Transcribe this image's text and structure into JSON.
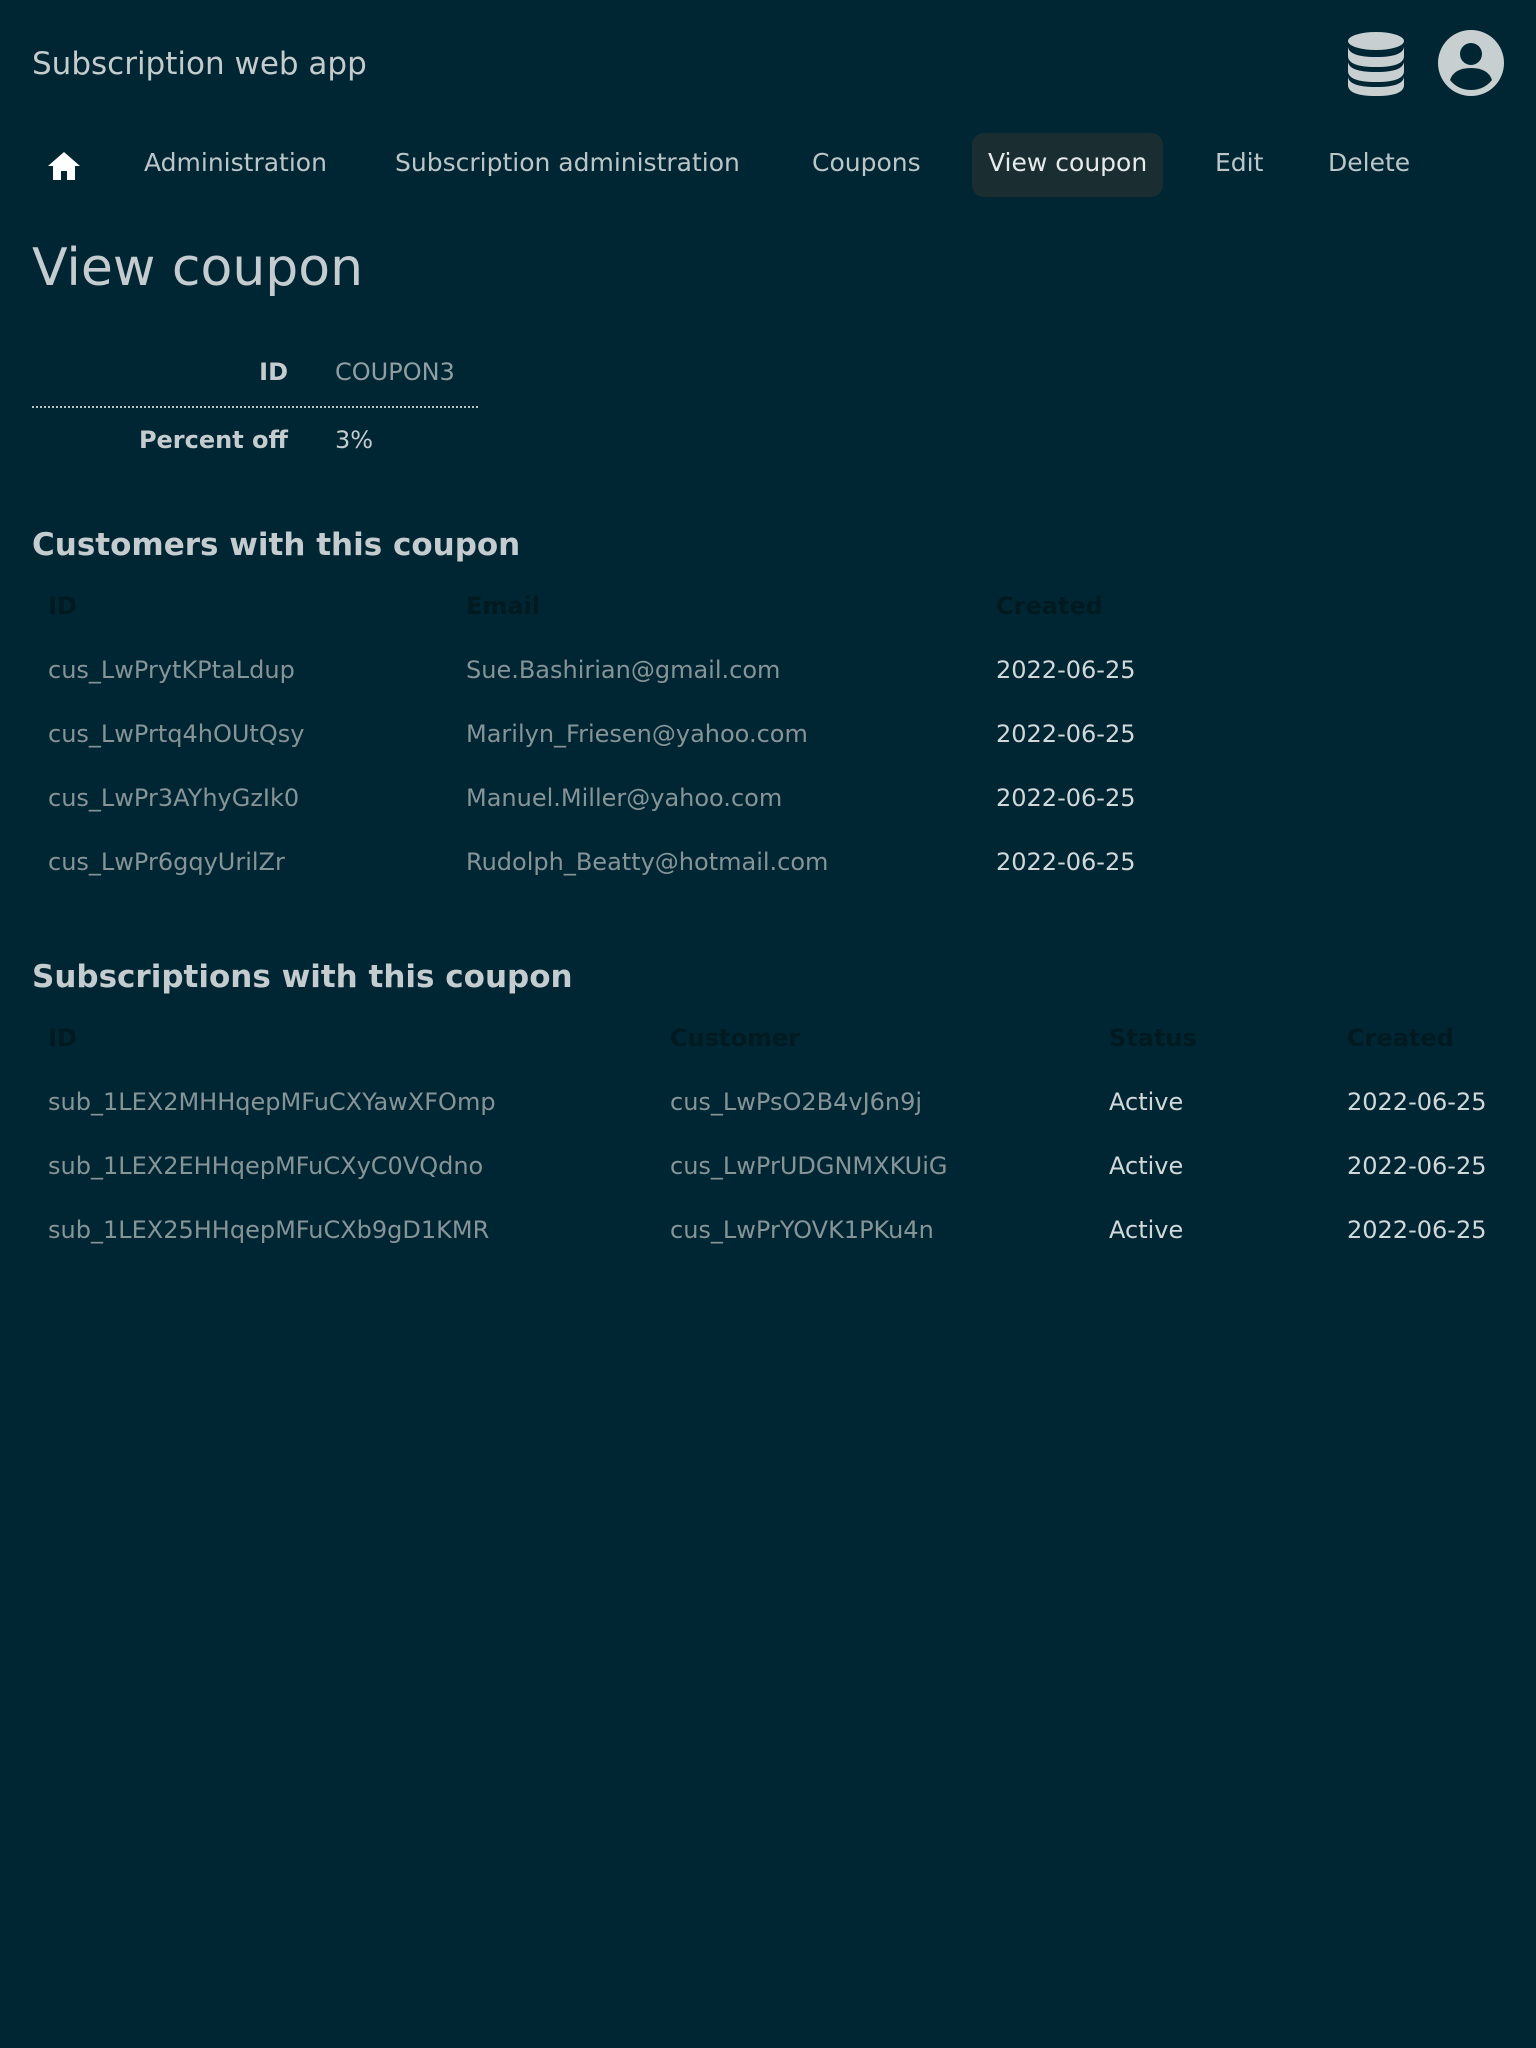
{
  "header": {
    "app_title": "Subscription web app",
    "icons": [
      "database-icon",
      "user-circle-icon"
    ]
  },
  "nav": {
    "home_icon": "home-icon",
    "items": [
      {
        "label": "Administration"
      },
      {
        "label": "Subscription administration"
      },
      {
        "label": "Coupons"
      },
      {
        "label": "View coupon",
        "active": true
      },
      {
        "label": "Edit"
      },
      {
        "label": "Delete"
      }
    ]
  },
  "page": {
    "title": "View coupon"
  },
  "coupon": {
    "id_label": "ID",
    "id_value": "COUPON3",
    "percent_label": "Percent off",
    "percent_value": "3%"
  },
  "customers": {
    "title": "Customers with this coupon",
    "headers": [
      "ID",
      "Email",
      "Created"
    ],
    "rows": [
      {
        "id": "cus_LwPrytKPtaLdup",
        "email": "Sue.Bashirian@gmail.com",
        "created": "2022-06-25"
      },
      {
        "id": "cus_LwPrtq4hOUtQsy",
        "email": "Marilyn_Friesen@yahoo.com",
        "created": "2022-06-25"
      },
      {
        "id": "cus_LwPr3AYhyGzIk0",
        "email": "Manuel.Miller@yahoo.com",
        "created": "2022-06-25"
      },
      {
        "id": "cus_LwPr6gqyUrilZr",
        "email": "Rudolph_Beatty@hotmail.com",
        "created": "2022-06-25"
      }
    ]
  },
  "subscriptions": {
    "title": "Subscriptions with this coupon",
    "headers": [
      "ID",
      "Customer",
      "Status",
      "Created"
    ],
    "rows": [
      {
        "id": "sub_1LEX2MHHqepMFuCXYawXFOmp",
        "customer": "cus_LwPsO2B4vJ6n9j",
        "status": "Active",
        "created": "2022-06-25"
      },
      {
        "id": "sub_1LEX2EHHqepMFuCXyC0VQdno",
        "customer": "cus_LwPrUDGNMXKUiG",
        "status": "Active",
        "created": "2022-06-25"
      },
      {
        "id": "sub_1LEX25HHqepMFuCXb9gD1KMR",
        "customer": "cus_LwPrYOVK1PKu4n",
        "status": "Active",
        "created": "2022-06-25"
      }
    ]
  },
  "colors": {
    "background": "#002633",
    "active_nav_bg": "#1a2e31",
    "link_text": "#869498",
    "header_text_dark": "#001a22"
  }
}
